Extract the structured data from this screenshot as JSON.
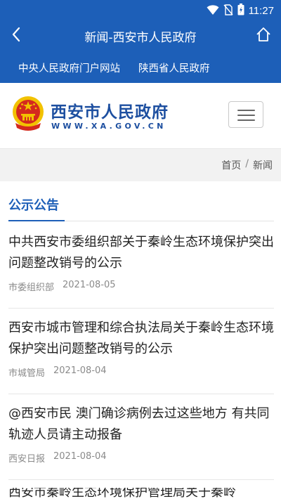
{
  "status_bar": {
    "time": "11:27"
  },
  "app_bar": {
    "title": "新闻-西安市人民政府"
  },
  "links": [
    {
      "label": "中央人民政府门户网站"
    },
    {
      "label": "陕西省人民政府"
    }
  ],
  "site": {
    "name": "西安市人民政府",
    "domain": "WWW.XA.GOV.CN"
  },
  "breadcrumb": {
    "home": "首页",
    "sep": "/",
    "current": "新闻"
  },
  "section": {
    "title": "公示公告"
  },
  "news": [
    {
      "title": "中共西安市委组织部关于秦岭生态环境保护突出问题整改销号的公示",
      "source": "市委组织部",
      "date": "2021-08-05"
    },
    {
      "title": "西安市城市管理和综合执法局关于秦岭生态环境保护突出问题整改销号的公示",
      "source": "市城管局",
      "date": "2021-08-04"
    },
    {
      "title": "@西安市民 澳门确诊病例去过这些地方 有共同轨迹人员请主动报备",
      "source": "西安日报",
      "date": "2021-08-04"
    },
    {
      "title": "西安市秦岭生态环境保护管理局关于秦岭",
      "source": "",
      "date": ""
    }
  ],
  "colors": {
    "primary": "#1d5fb8",
    "brand_text": "#1d4fa0",
    "emblem_red": "#d42a1e",
    "emblem_gold": "#f2c200"
  },
  "icons": [
    "wifi-icon",
    "no-sim-icon",
    "battery-icon",
    "back-arrow-icon",
    "home-icon",
    "menu-icon",
    "national-emblem-icon"
  ]
}
